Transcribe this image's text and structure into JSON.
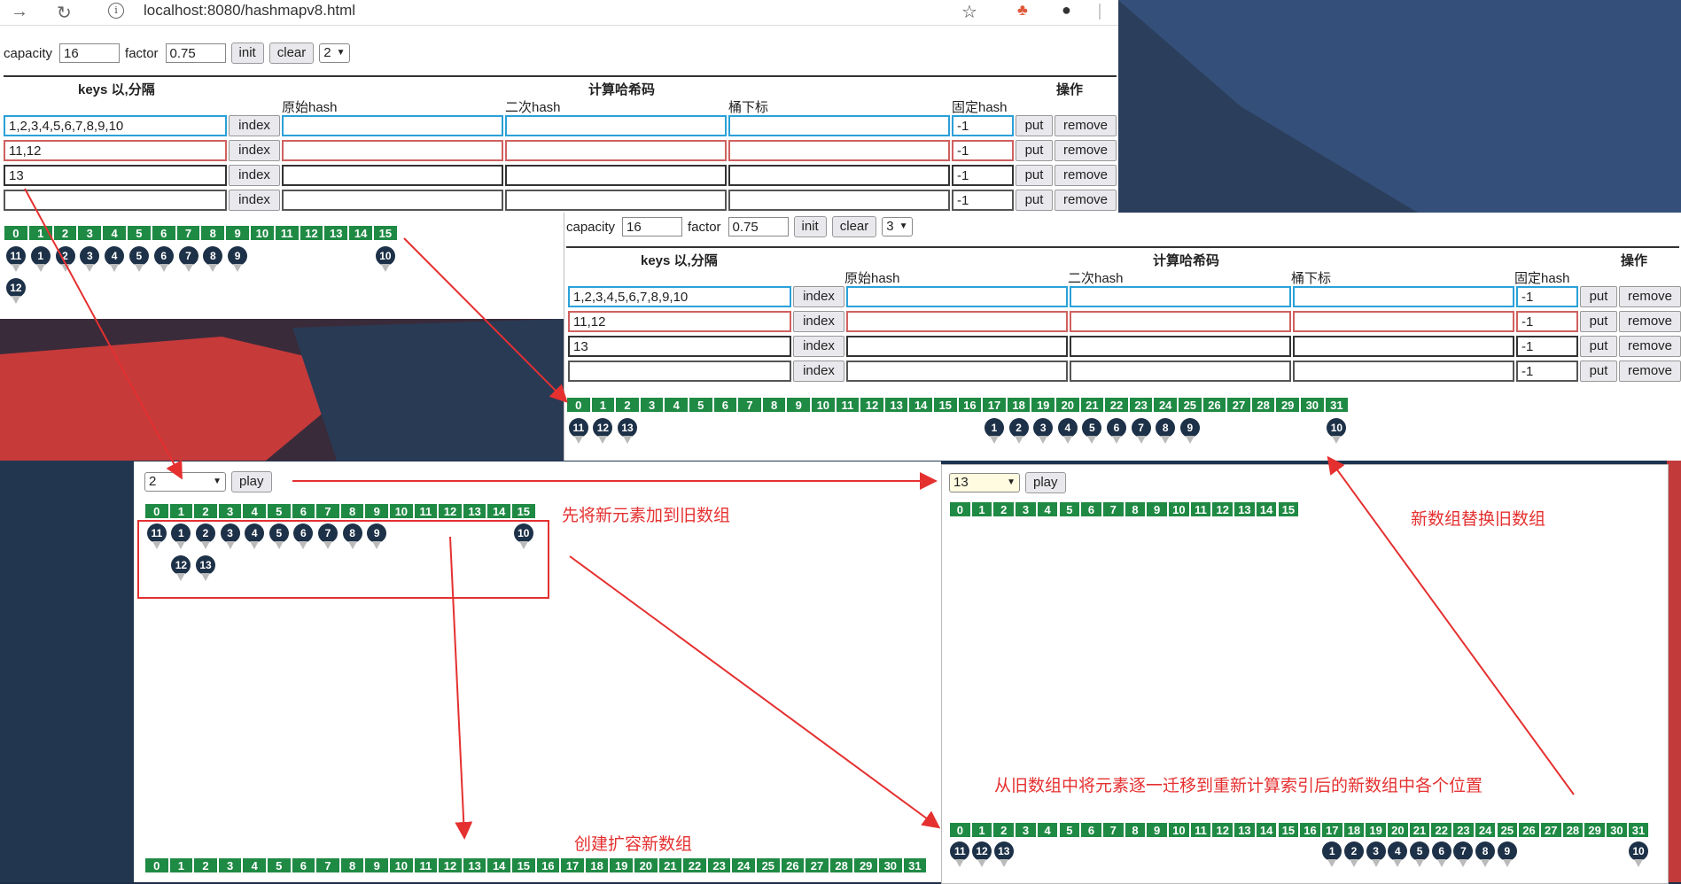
{
  "browser": {
    "url": "localhost:8080/hashmapv8.html"
  },
  "form": {
    "capacity_label": "capacity",
    "capacity_value": "16",
    "factor_label": "factor",
    "factor_value": "0.75",
    "init_label": "init",
    "clear_label": "clear"
  },
  "main": {
    "step_value": "2",
    "header_keys": "keys 以,分隔",
    "header_calc": "计算哈希码",
    "header_ops": "操作",
    "sub_raw": "原始hash",
    "sub_second": "二次hash",
    "sub_index": "桶下标",
    "sub_fixed": "固定hash",
    "rows": [
      {
        "keys": "1,2,3,4,5,6,7,8,9,10",
        "index_label": "index",
        "fixed": "-1",
        "put": "put",
        "remove": "remove"
      },
      {
        "keys": "11,12",
        "index_label": "index",
        "fixed": "-1",
        "put": "put",
        "remove": "remove"
      },
      {
        "keys": "13",
        "index_label": "index",
        "fixed": "-1",
        "put": "put",
        "remove": "remove"
      },
      {
        "keys": "",
        "index_label": "index",
        "fixed": "-1",
        "put": "put",
        "remove": "remove"
      }
    ]
  },
  "second": {
    "step_value": "3",
    "rows": [
      {
        "keys": "1,2,3,4,5,6,7,8,9,10"
      },
      {
        "keys": "11,12"
      },
      {
        "keys": "13"
      },
      {
        "keys": ""
      }
    ]
  },
  "buckets16": [
    "0",
    "1",
    "2",
    "3",
    "4",
    "5",
    "6",
    "7",
    "8",
    "9",
    "10",
    "11",
    "12",
    "13",
    "14",
    "15"
  ],
  "buckets32": [
    "0",
    "1",
    "2",
    "3",
    "4",
    "5",
    "6",
    "7",
    "8",
    "9",
    "10",
    "11",
    "12",
    "13",
    "14",
    "15",
    "16",
    "17",
    "18",
    "19",
    "20",
    "21",
    "22",
    "23",
    "24",
    "25",
    "26",
    "27",
    "28",
    "29",
    "30",
    "31"
  ],
  "play_left": {
    "select_value": "2",
    "play_label": "play"
  },
  "play_right": {
    "select_value": "13",
    "play_label": "play"
  },
  "annotations": {
    "add_to_old": "先将新元素加到旧数组",
    "replace": "新数组替换旧数组",
    "migrate": "从旧数组中将元素逐一迁移到重新计算索引后的新数组中各个位置",
    "create_new": "创建扩容新数组"
  },
  "nodes": {
    "main_chain": [
      {
        "bucket": 0,
        "labels": [
          "11",
          "12"
        ]
      },
      {
        "bucket": 1,
        "labels": [
          "1"
        ]
      },
      {
        "bucket": 2,
        "labels": [
          "2"
        ]
      },
      {
        "bucket": 3,
        "labels": [
          "3"
        ]
      },
      {
        "bucket": 4,
        "labels": [
          "4"
        ]
      },
      {
        "bucket": 5,
        "labels": [
          "5"
        ]
      },
      {
        "bucket": 6,
        "labels": [
          "6"
        ]
      },
      {
        "bucket": 7,
        "labels": [
          "7"
        ]
      },
      {
        "bucket": 8,
        "labels": [
          "8"
        ]
      },
      {
        "bucket": 9,
        "labels": [
          "9"
        ]
      },
      {
        "bucket": 15,
        "labels": [
          "10"
        ]
      }
    ],
    "second_chain": [
      {
        "bucket": 0,
        "labels": [
          "11"
        ]
      },
      {
        "bucket": 1,
        "labels": [
          "12"
        ]
      },
      {
        "bucket": 2,
        "labels": [
          "13"
        ]
      },
      {
        "bucket": 17,
        "labels": [
          "1"
        ]
      },
      {
        "bucket": 18,
        "labels": [
          "2"
        ]
      },
      {
        "bucket": 19,
        "labels": [
          "3"
        ]
      },
      {
        "bucket": 20,
        "labels": [
          "4"
        ]
      },
      {
        "bucket": 21,
        "labels": [
          "5"
        ]
      },
      {
        "bucket": 22,
        "labels": [
          "6"
        ]
      },
      {
        "bucket": 23,
        "labels": [
          "7"
        ]
      },
      {
        "bucket": 24,
        "labels": [
          "8"
        ]
      },
      {
        "bucket": 25,
        "labels": [
          "9"
        ]
      },
      {
        "bucket": 31,
        "labels": [
          "10"
        ]
      }
    ],
    "left_chain": [
      {
        "bucket": 0,
        "labels": [
          "11"
        ]
      },
      {
        "bucket": 1,
        "labels": [
          "1",
          "12"
        ]
      },
      {
        "bucket": 2,
        "labels": [
          "2",
          "13"
        ]
      },
      {
        "bucket": 3,
        "labels": [
          "3"
        ]
      },
      {
        "bucket": 4,
        "labels": [
          "4"
        ]
      },
      {
        "bucket": 5,
        "labels": [
          "5"
        ]
      },
      {
        "bucket": 6,
        "labels": [
          "6"
        ]
      },
      {
        "bucket": 7,
        "labels": [
          "7"
        ]
      },
      {
        "bucket": 8,
        "labels": [
          "8"
        ]
      },
      {
        "bucket": 9,
        "labels": [
          "9"
        ]
      },
      {
        "bucket": 15,
        "labels": [
          "10"
        ]
      }
    ],
    "right_chain": [
      {
        "bucket": 0,
        "labels": [
          "11"
        ]
      },
      {
        "bucket": 1,
        "labels": [
          "12"
        ]
      },
      {
        "bucket": 2,
        "labels": [
          "13"
        ]
      },
      {
        "bucket": 17,
        "labels": [
          "1"
        ]
      },
      {
        "bucket": 18,
        "labels": [
          "2"
        ]
      },
      {
        "bucket": 19,
        "labels": [
          "3"
        ]
      },
      {
        "bucket": 20,
        "labels": [
          "4"
        ]
      },
      {
        "bucket": 21,
        "labels": [
          "5"
        ]
      },
      {
        "bucket": 22,
        "labels": [
          "6"
        ]
      },
      {
        "bucket": 23,
        "labels": [
          "7"
        ]
      },
      {
        "bucket": 24,
        "labels": [
          "8"
        ]
      },
      {
        "bucket": 25,
        "labels": [
          "9"
        ]
      },
      {
        "bucket": 31,
        "labels": [
          "10"
        ]
      }
    ]
  }
}
